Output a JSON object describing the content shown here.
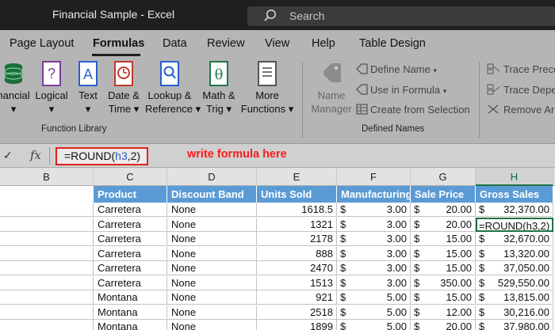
{
  "window": {
    "title": "Financial Sample  -  Excel",
    "search_label": "Search"
  },
  "tabs": [
    {
      "label": "Page Layout",
      "active": false
    },
    {
      "label": "Formulas",
      "active": true
    },
    {
      "label": "Data",
      "active": false
    },
    {
      "label": "Review",
      "active": false
    },
    {
      "label": "View",
      "active": false
    },
    {
      "label": "Help",
      "active": false
    },
    {
      "label": "Table Design",
      "active": false
    }
  ],
  "ribbon": {
    "function_library": {
      "label": "Function Library",
      "buttons": [
        {
          "line1": "nancial",
          "line2": "▾",
          "icon": "database-icon"
        },
        {
          "line1": "Logical",
          "line2": "▾",
          "icon": "question-book-icon"
        },
        {
          "line1": "Text",
          "line2": "▾",
          "icon": "text-book-icon"
        },
        {
          "line1": "Date &",
          "line2": "Time ▾",
          "icon": "clock-book-icon"
        },
        {
          "line1": "Lookup &",
          "line2": "Reference ▾",
          "icon": "magnifier-book-icon"
        },
        {
          "line1": "Math &",
          "line2": "Trig ▾",
          "icon": "theta-book-icon"
        },
        {
          "line1": "More",
          "line2": "Functions ▾",
          "icon": "more-book-icon"
        }
      ]
    },
    "defined_names": {
      "label": "Defined Names",
      "name_manager_line1": "Name",
      "name_manager_line2": "Manager",
      "define_name": "Define Name",
      "use_in_formula": "Use in Formula",
      "create_from_selection": "Create from Selection"
    },
    "formula_auditing": {
      "trace_precedents": "Trace Prece",
      "trace_dependents": "Trace Depe",
      "remove_arrows": "Remove Ar"
    }
  },
  "formula_bar": {
    "check": "✓",
    "fx": "fx",
    "formula_prefix": "=ROUND(",
    "formula_ref": "h3",
    "formula_suffix": ",2)",
    "annotation": "write formula here"
  },
  "columns": [
    "B",
    "C",
    "D",
    "E",
    "F",
    "G",
    "H"
  ],
  "table": {
    "headers": [
      "Product",
      "Discount Band",
      "Units Sold",
      "Manufacturing",
      "Sale Price",
      "Gross Sales"
    ],
    "rows": [
      {
        "product": "Carretera",
        "discount": "None",
        "units": "1618.5",
        "mfg": "3.00",
        "price": "20.00",
        "gross": "32,370.00"
      },
      {
        "product": "Carretera",
        "discount": "None",
        "units": "1321",
        "mfg": "3.00",
        "price": "20.00",
        "gross": "=ROUND(h3,2)"
      },
      {
        "product": "Carretera",
        "discount": "None",
        "units": "2178",
        "mfg": "3.00",
        "price": "15.00",
        "gross": "32,670.00"
      },
      {
        "product": "Carretera",
        "discount": "None",
        "units": "888",
        "mfg": "3.00",
        "price": "15.00",
        "gross": "13,320.00"
      },
      {
        "product": "Carretera",
        "discount": "None",
        "units": "2470",
        "mfg": "3.00",
        "price": "15.00",
        "gross": "37,050.00"
      },
      {
        "product": "Carretera",
        "discount": "None",
        "units": "1513",
        "mfg": "3.00",
        "price": "350.00",
        "gross": "529,550.00"
      },
      {
        "product": "Montana",
        "discount": "None",
        "units": "921",
        "mfg": "5.00",
        "price": "15.00",
        "gross": "13,815.00"
      },
      {
        "product": "Montana",
        "discount": "None",
        "units": "2518",
        "mfg": "5.00",
        "price": "12.00",
        "gross": "30,216.00"
      },
      {
        "product": "Montana",
        "discount": "None",
        "units": "1899",
        "mfg": "5.00",
        "price": "20.00",
        "gross": "37,980.00"
      }
    ],
    "currency_symbol": "$"
  },
  "colors": {
    "header_blue": "#5b9bd5",
    "annotation_red": "#ff1a1a",
    "selection_green": "#1e7145"
  }
}
